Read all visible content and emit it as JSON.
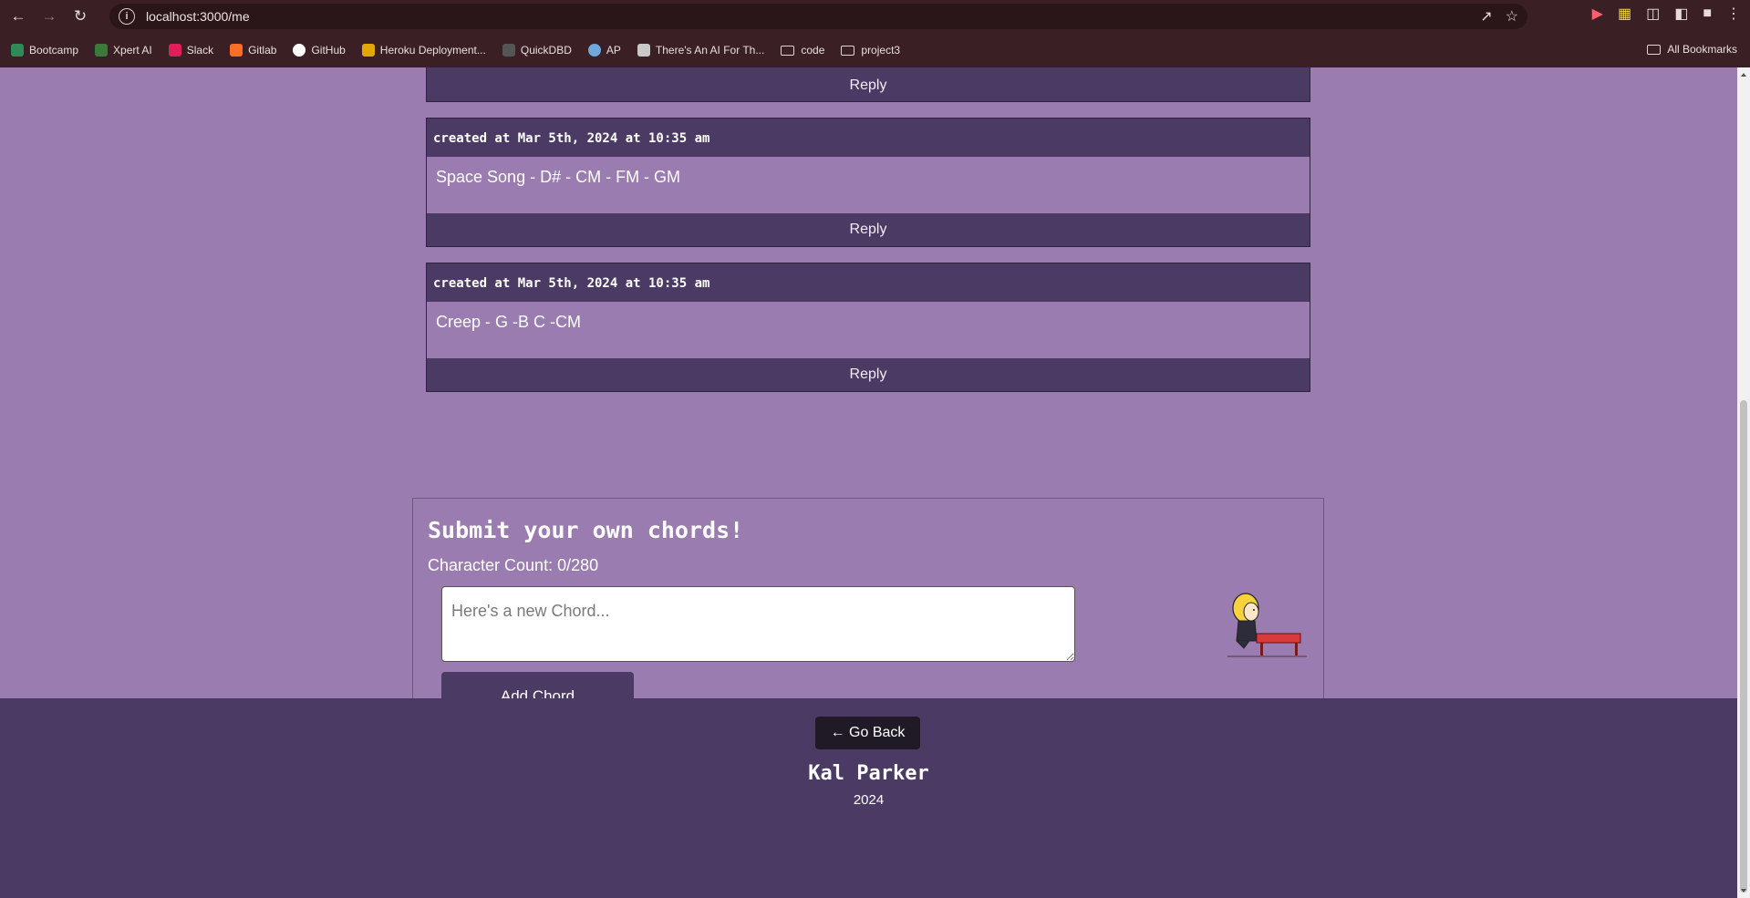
{
  "browser": {
    "url": "localhost:3000/me",
    "bookmarks": [
      {
        "label": "Bootcamp",
        "icon": "bootcamp-icon",
        "color": "#2e8b57"
      },
      {
        "label": "Xpert AI",
        "icon": "xpert-icon",
        "color": "#3c7a3c"
      },
      {
        "label": "Slack",
        "icon": "slack-icon",
        "color": "#e01e5a"
      },
      {
        "label": "Gitlab",
        "icon": "gitlab-icon",
        "color": "#fc6d26"
      },
      {
        "label": "GitHub",
        "icon": "github-icon",
        "color": "#ffffff"
      },
      {
        "label": "Heroku Deployment...",
        "icon": "heroku-icon",
        "color": "#e0a800"
      },
      {
        "label": "QuickDBD",
        "icon": "quickdbd-icon",
        "color": "#555555"
      },
      {
        "label": "AP",
        "icon": "ap-icon",
        "color": "#6fa8dc"
      },
      {
        "label": "There's An AI For Th...",
        "icon": "ai-icon",
        "color": "#c9c9c9"
      },
      {
        "label": "code",
        "icon": "folder-icon"
      },
      {
        "label": "project3",
        "icon": "folder-icon"
      }
    ],
    "all_bookmarks": "All Bookmarks"
  },
  "chords": {
    "top_reply": "Reply",
    "items": [
      {
        "created": "created at Mar 5th, 2024 at 10:35 am",
        "text": "Space Song - D# - CM - FM - GM",
        "reply": "Reply"
      },
      {
        "created": "created at Mar 5th, 2024 at 10:35 am",
        "text": "Creep - G -B C -CM",
        "reply": "Reply"
      }
    ]
  },
  "form": {
    "title": "Submit your own chords!",
    "char_count": "Character Count: 0/280",
    "placeholder": "Here's a new Chord...",
    "button": "Add Chord"
  },
  "footer": {
    "back": "← Go Back",
    "name": "Kal Parker",
    "year": "2024"
  },
  "colors": {
    "page_bg": "#9b7cb1",
    "accent": "#4b3a63",
    "chrome": "#3a2024"
  }
}
